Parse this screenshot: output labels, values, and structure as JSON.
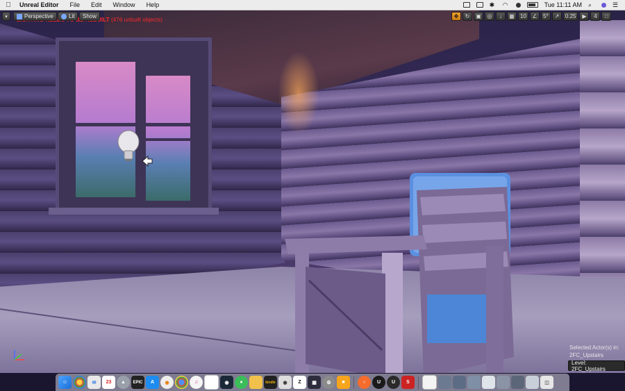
{
  "menubar": {
    "app_name": "Unreal Editor",
    "menus": [
      "File",
      "Edit",
      "Window",
      "Help"
    ],
    "clock": "Tue 11:11 AM"
  },
  "viewport_toolbar": {
    "perspective_label": "Perspective",
    "lit_label": "Lit",
    "show_label": "Show",
    "grid_snap_value": "10",
    "rotation_snap_value": "5°",
    "scale_snap_value": "0.25",
    "camera_speed_value": "4"
  },
  "warning": {
    "title": "LIGHTING NEEDS TO BE REBUILT",
    "detail": "(476 unbuilt objects)"
  },
  "selection": {
    "line1": "Selected Actor(s) in:",
    "line2": "2FC_Upstairs",
    "level_badge": "Level:  2FC_Upstairs"
  },
  "dock": {
    "icons": [
      "finder-icon",
      "chrome-icon",
      "mail-icon",
      "calendar-icon",
      "launchpad-icon",
      "epic-games-icon",
      "app-store-icon",
      "blender-icon",
      "chrome2-icon",
      "itunes-icon",
      "notes-icon",
      "steam-icon",
      "messages-icon",
      "folder-icon",
      "kindle-icon",
      "photoshop-icon",
      "zbrush-icon",
      "premiere-icon",
      "settings-icon",
      "unity-icon",
      "origin-icon",
      "unreal-icon",
      "unreal2-icon",
      "substance-icon",
      "file-icon",
      "window1-icon",
      "window2-icon",
      "window3-icon",
      "window4-icon",
      "window5-icon",
      "window6-icon",
      "window7-icon",
      "trash-icon"
    ],
    "kindle_label": "kindle",
    "epic_label": "EPIC"
  },
  "colors": {
    "warning": "#ff2a2a",
    "active_tool": "#f0a030"
  }
}
